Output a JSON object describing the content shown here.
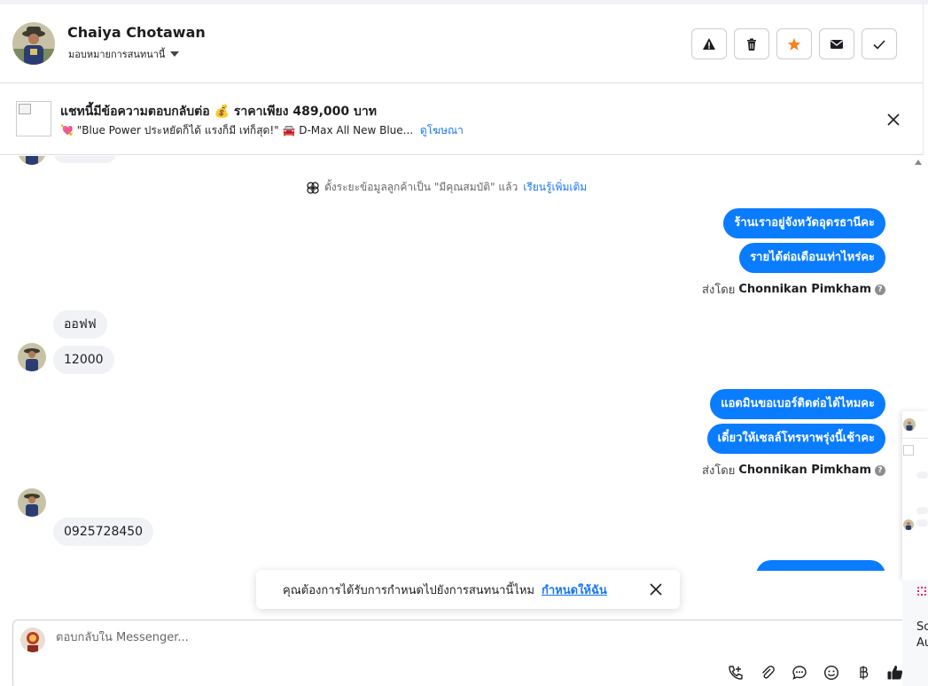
{
  "header": {
    "name": "Chaiya Chotawan",
    "assign_label": "มอบหมายการสนทนานี้"
  },
  "banner": {
    "title": "แชทนี้มีข้อความตอบกลับต่อ 💰 ราคาเพียง 489,000 บาท",
    "subtitle": "💘 \"Blue Power ประหยัดก็ได้ แรงก็มี เท่ก็สุด!\" 🚘 D-Max All New Blue...",
    "link": "ดูโฆษณา"
  },
  "messages": {
    "system_note": "ตั้งระยะข้อมูลลูกค้าเป็น \"มีคุณสมบัติ\" แล้ว",
    "system_link": "เรียนรู้เพิ่มเติม",
    "out_1": "ร้านเราอยู่จังหวัดอุดรธานีคะ",
    "out_2": "รายได้ต่อเดือนเท่าไหร่คะ",
    "sent_by_prefix": "ส่งโดย",
    "sent_by_name": "Chonnikan Pimkham",
    "in_1": "ออฟฟ",
    "in_2": "12000",
    "out_3": "แอดมินขอเบอร์ติดต่อได้ไหมคะ",
    "out_4": "เดี๋ยวให้เซลล์โทรหาพรุ่งนี้เช้าคะ",
    "in_3": "0925728450"
  },
  "toast": {
    "text": "คุณต้องการได้รับการกำหนดไปยังการสนทนานี้ไหม",
    "link": "กำหนดให้ฉัน"
  },
  "composer": {
    "placeholder": "ตอบกลับใน Messenger..."
  },
  "side_panel": {
    "snippet_1": "So",
    "snippet_2": "Au"
  },
  "colors": {
    "accent": "#1877f2",
    "outgoing_bubble": "#0a7cff",
    "incoming_bubble": "#f0f2f5",
    "star": "#f5821f"
  }
}
